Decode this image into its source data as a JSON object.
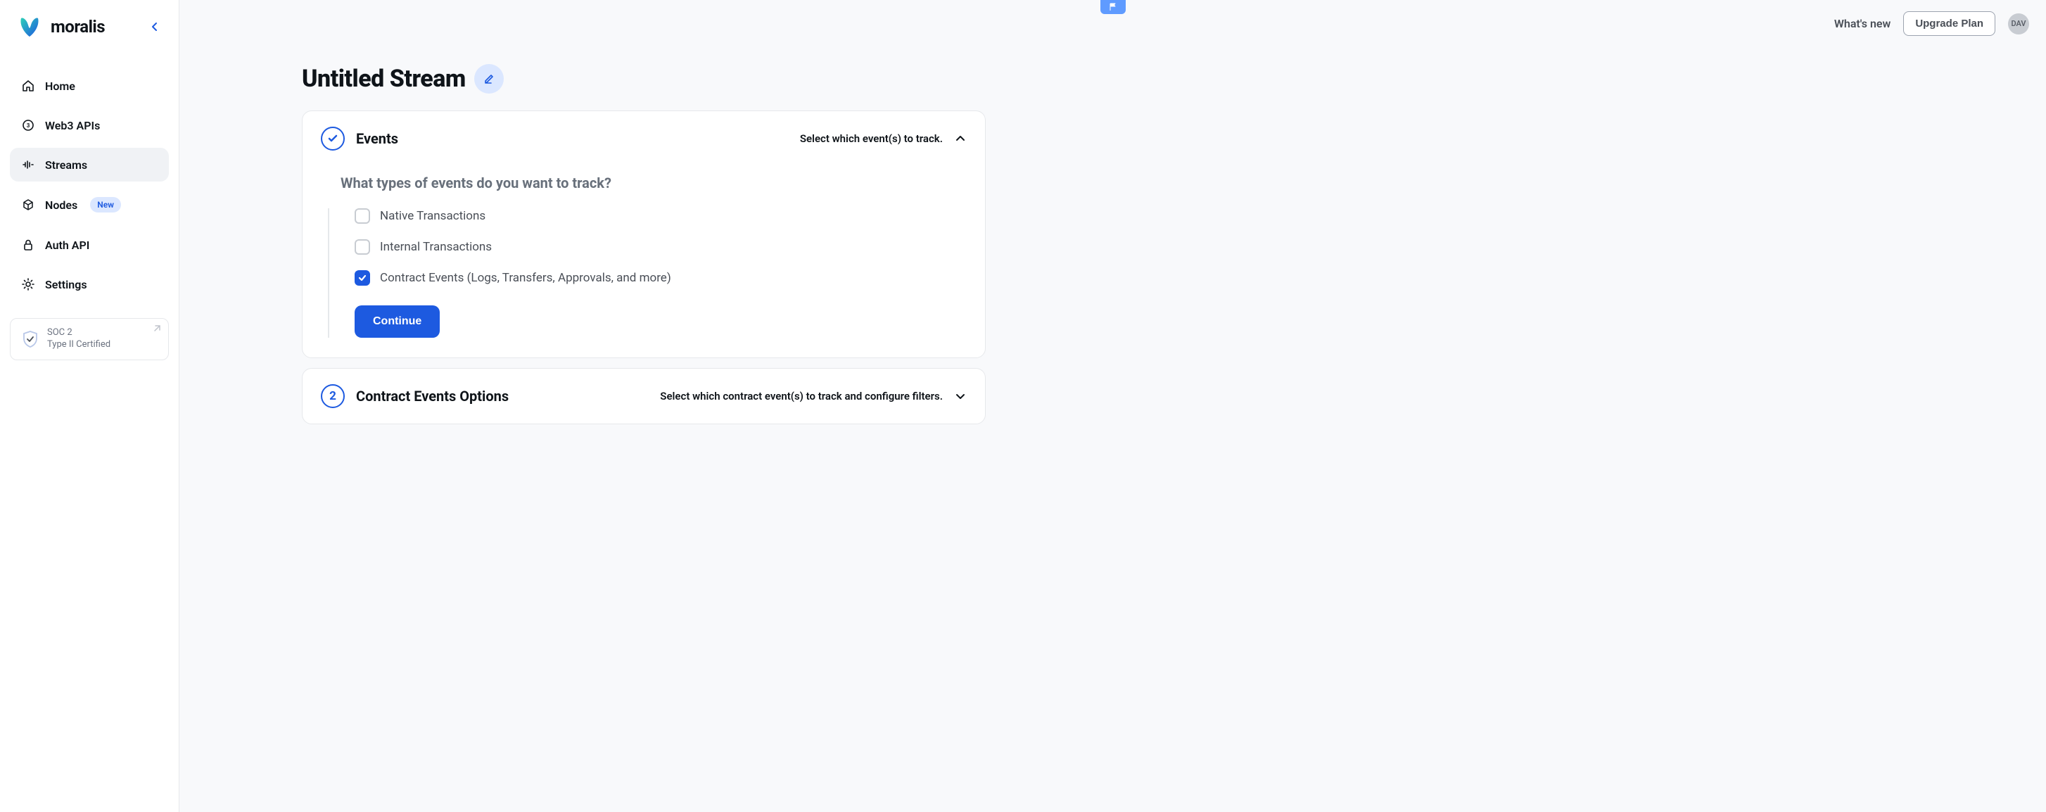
{
  "brand": "moralis",
  "sidebar": {
    "items": [
      {
        "label": "Home"
      },
      {
        "label": "Web3 APIs"
      },
      {
        "label": "Streams"
      },
      {
        "label": "Nodes",
        "badge": "New"
      },
      {
        "label": "Auth API"
      },
      {
        "label": "Settings"
      }
    ],
    "soc": {
      "line1": "SOC 2",
      "line2": "Type II Certified"
    }
  },
  "topbar": {
    "whats_new": "What's new",
    "upgrade": "Upgrade Plan",
    "avatar": "DAV"
  },
  "page": {
    "title": "Untitled Stream"
  },
  "events": {
    "title": "Events",
    "subtitle": "Select which event(s) to track.",
    "question": "What types of events do you want to track?",
    "options": [
      {
        "label": "Native Transactions",
        "checked": false
      },
      {
        "label": "Internal Transactions",
        "checked": false
      },
      {
        "label": "Contract Events (Logs, Transfers, Approvals, and more)",
        "checked": true
      }
    ],
    "continue": "Continue"
  },
  "contract_options": {
    "step": "2",
    "title": "Contract Events Options",
    "subtitle": "Select which contract event(s) to track and configure filters."
  }
}
